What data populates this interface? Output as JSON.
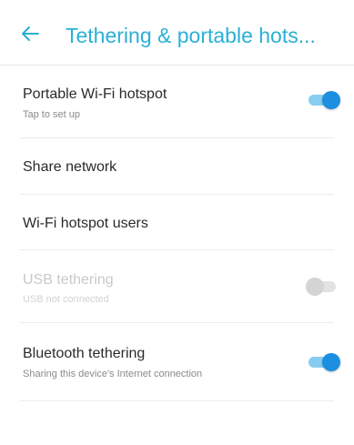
{
  "header": {
    "title": "Tethering & portable hots..."
  },
  "colors": {
    "accent": "#2ab0d6",
    "switch_on_thumb": "#1d8fe0",
    "switch_on_track": "#86cdef",
    "switch_off": "#d4d4d4"
  },
  "settings": {
    "wifi_hotspot": {
      "title": "Portable Wi-Fi hotspot",
      "subtitle": "Tap to set up",
      "enabled": true
    },
    "share_network": {
      "title": "Share network"
    },
    "hotspot_users": {
      "title": "Wi-Fi hotspot users"
    },
    "usb_tethering": {
      "title": "USB tethering",
      "subtitle": "USB not connected",
      "enabled": false,
      "available": false
    },
    "bluetooth_tethering": {
      "title": "Bluetooth tethering",
      "subtitle": "Sharing this device's Internet connection",
      "enabled": true
    }
  },
  "icons": {
    "back": "arrow-back-icon"
  }
}
